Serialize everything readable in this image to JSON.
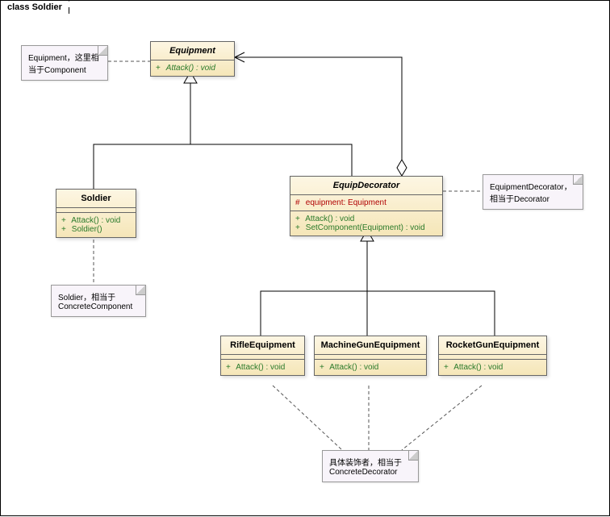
{
  "diagram": {
    "title": "class Soldier",
    "classes": {
      "Equipment": {
        "name": "Equipment",
        "abstract": true,
        "ops": [
          {
            "vis": "+",
            "sig": "Attack() : void",
            "italic": true
          }
        ]
      },
      "Soldier": {
        "name": "Soldier",
        "ops": [
          {
            "vis": "+",
            "sig": "Attack() : void"
          },
          {
            "vis": "+",
            "sig": "Soldier()"
          }
        ]
      },
      "EquipDecorator": {
        "name": "EquipDecorator",
        "abstract": true,
        "attrs": [
          {
            "vis": "#",
            "sig": "equipment: Equipment"
          }
        ],
        "ops": [
          {
            "vis": "+",
            "sig": "Attack() : void"
          },
          {
            "vis": "+",
            "sig": "SetComponent(Equipment) : void"
          }
        ]
      },
      "RifleEquipment": {
        "name": "RifleEquipment",
        "ops": [
          {
            "vis": "+",
            "sig": "Attack() : void"
          }
        ]
      },
      "MachineGunEquipment": {
        "name": "MachineGunEquipment",
        "ops": [
          {
            "vis": "+",
            "sig": "Attack() : void"
          }
        ]
      },
      "RocketGunEquipment": {
        "name": "RocketGunEquipment",
        "ops": [
          {
            "vis": "+",
            "sig": "Attack() : void"
          }
        ]
      }
    },
    "notes": {
      "n1": "Equipment，这里相当于Component",
      "n2": "Soldier，相当于ConcreteComponent",
      "n3": "EquipmentDecorator，相当于Decorator",
      "n4": "具体装饰者，相当于ConcreteDecorator"
    }
  },
  "chart_data": {
    "type": "uml_class_diagram",
    "title": "class Soldier",
    "classes": [
      {
        "name": "Equipment",
        "abstract": true,
        "operations": [
          "+ Attack() : void"
        ]
      },
      {
        "name": "Soldier",
        "operations": [
          "+ Attack() : void",
          "+ Soldier()"
        ]
      },
      {
        "name": "EquipDecorator",
        "abstract": true,
        "attributes": [
          "# equipment: Equipment"
        ],
        "operations": [
          "+ Attack() : void",
          "+ SetComponent(Equipment) : void"
        ]
      },
      {
        "name": "RifleEquipment",
        "operations": [
          "+ Attack() : void"
        ]
      },
      {
        "name": "MachineGunEquipment",
        "operations": [
          "+ Attack() : void"
        ]
      },
      {
        "name": "RocketGunEquipment",
        "operations": [
          "+ Attack() : void"
        ]
      }
    ],
    "relationships": [
      {
        "from": "Soldier",
        "to": "Equipment",
        "type": "generalization"
      },
      {
        "from": "EquipDecorator",
        "to": "Equipment",
        "type": "generalization"
      },
      {
        "from": "EquipDecorator",
        "to": "Equipment",
        "type": "aggregation"
      },
      {
        "from": "RifleEquipment",
        "to": "EquipDecorator",
        "type": "generalization"
      },
      {
        "from": "MachineGunEquipment",
        "to": "EquipDecorator",
        "type": "generalization"
      },
      {
        "from": "RocketGunEquipment",
        "to": "EquipDecorator",
        "type": "generalization"
      }
    ],
    "notes": [
      {
        "text": "Equipment，这里相当于Component",
        "attached_to": "Equipment"
      },
      {
        "text": "Soldier，相当于ConcreteComponent",
        "attached_to": "Soldier"
      },
      {
        "text": "EquipmentDecorator，相当于Decorator",
        "attached_to": "EquipDecorator"
      },
      {
        "text": "具体装饰者，相当于ConcreteDecorator",
        "attached_to": [
          "RifleEquipment",
          "MachineGunEquipment",
          "RocketGunEquipment"
        ]
      }
    ]
  }
}
